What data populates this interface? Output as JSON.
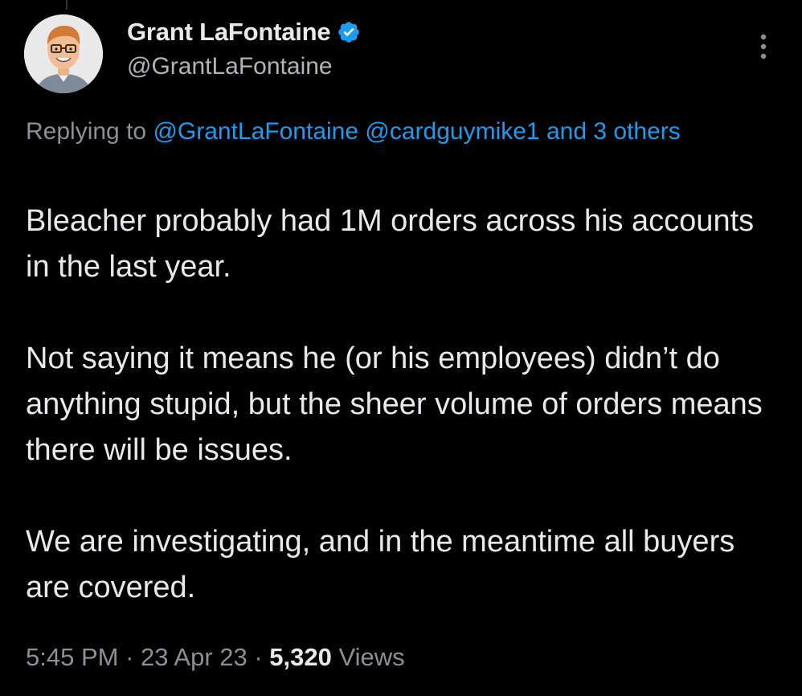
{
  "tweet": {
    "author": {
      "display_name": "Grant LaFontaine",
      "handle": "@GrantLaFontaine",
      "verified": true,
      "avatar_icon": "cartoon-avatar-with-glasses"
    },
    "reply_context": {
      "prefix": "Replying to ",
      "mentions": [
        "@GrantLaFontaine",
        "@cardguymike1"
      ],
      "others_text": "and 3 others"
    },
    "paragraphs": [
      "Bleacher probably had 1M orders across his accounts in the last year.",
      "Not saying it means he (or his employees) didn’t do anything stupid, but the sheer volume of orders means there will be issues.",
      "We are investigating, and in the meantime all buyers are covered."
    ],
    "meta": {
      "time": "5:45 PM",
      "separator": " · ",
      "date": "23 Apr 23",
      "views_count": "5,320",
      "views_label": " Views"
    }
  },
  "icons": {
    "verified": "verified-badge-icon",
    "more": "more-options-icon"
  },
  "colors": {
    "background": "#000000",
    "primary_text": "#e7e9ea",
    "secondary_text": "#8b9096",
    "link": "#1d9bf0",
    "verified_badge": "#1d9bf0"
  }
}
